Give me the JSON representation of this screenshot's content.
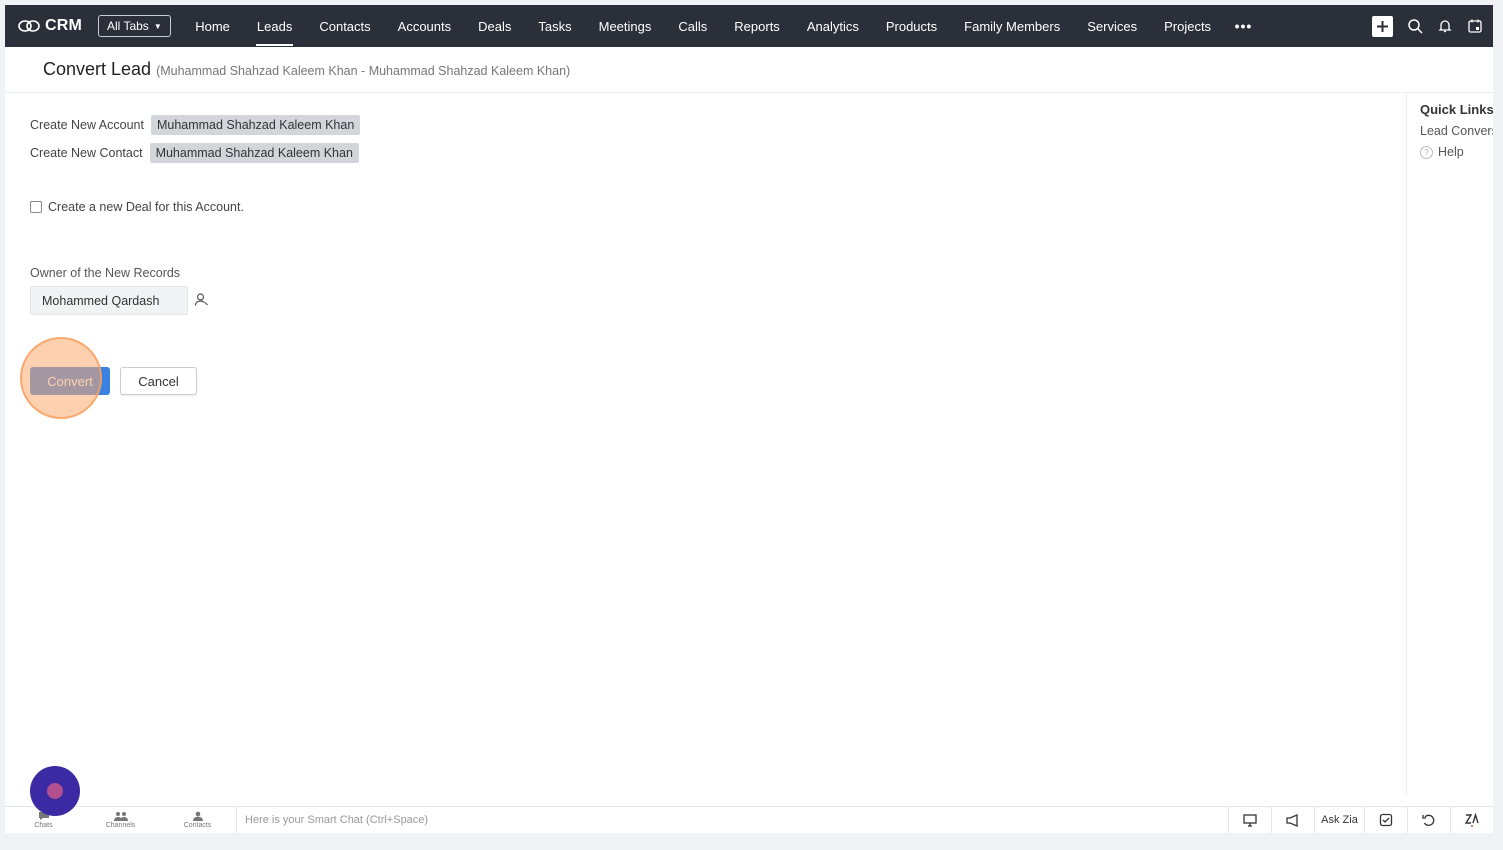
{
  "app": {
    "logo_text": "CRM",
    "all_tabs_label": "All Tabs"
  },
  "nav": {
    "items": [
      {
        "label": "Home"
      },
      {
        "label": "Leads"
      },
      {
        "label": "Contacts"
      },
      {
        "label": "Accounts"
      },
      {
        "label": "Deals"
      },
      {
        "label": "Tasks"
      },
      {
        "label": "Meetings"
      },
      {
        "label": "Calls"
      },
      {
        "label": "Reports"
      },
      {
        "label": "Analytics"
      },
      {
        "label": "Products"
      },
      {
        "label": "Family Members"
      },
      {
        "label": "Services"
      },
      {
        "label": "Projects"
      }
    ],
    "active": "Leads",
    "more_label": "•••"
  },
  "header": {
    "title": "Convert Lead",
    "subtitle": "(Muhammad Shahzad Kaleem Khan - Muhammad Shahzad Kaleem Khan)"
  },
  "form": {
    "create_account_label": "Create New Account",
    "create_account_value": "Muhammad Shahzad Kaleem Khan",
    "create_contact_label": "Create New Contact",
    "create_contact_value": "Muhammad Shahzad Kaleem Khan",
    "deal_checkbox_label": "Create a new Deal for this Account.",
    "deal_checked": false,
    "owner_label": "Owner of the New Records",
    "owner_value": "Mohammed Qardash",
    "convert_label": "Convert",
    "cancel_label": "Cancel"
  },
  "quick_links": {
    "title": "Quick Links",
    "link_1": "Lead Conversion",
    "help": "Help"
  },
  "bottom": {
    "chats": "Chats",
    "channels": "Channels",
    "contacts": "Contacts",
    "smartchat_placeholder": "Here is your Smart Chat (Ctrl+Space)",
    "ask_zia": "Ask Zia"
  },
  "colors": {
    "topbar": "#2b2f3a",
    "primary_button": "#3b82e0",
    "highlight": "#fbaa6e",
    "fab": "#3b2aa3"
  }
}
